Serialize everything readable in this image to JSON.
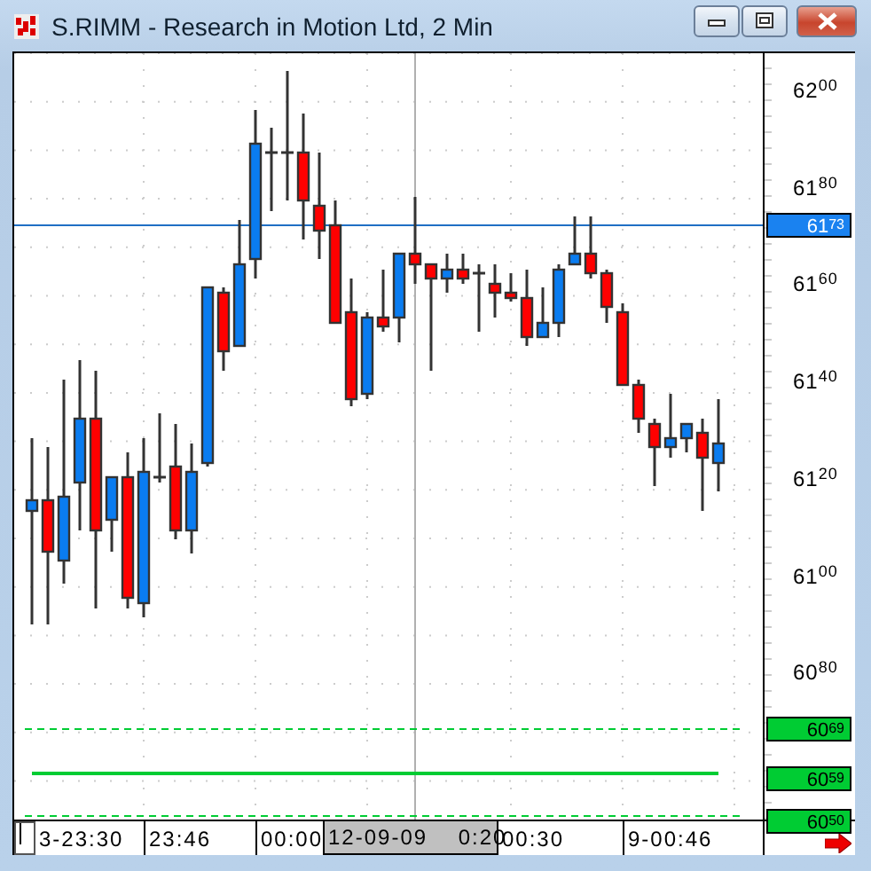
{
  "window": {
    "title": "S.RIMM - Research in Motion Ltd, 2 Min"
  },
  "price_axis": {
    "labels": [
      "62$^{00}$",
      "61$^{80}$",
      "61$^{60}$",
      "61$^{40}$",
      "61$^{20}$",
      "61$^{00}$",
      "60$^{80}$"
    ],
    "markers": [
      {
        "label": "61$^{73}$",
        "color": "#1a82f0"
      },
      {
        "label": "60$^{69}$",
        "color": "#00cc33"
      },
      {
        "label": "60$^{59}$",
        "color": "#00cc33"
      },
      {
        "label": "60$^{50}$",
        "color": "#00cc33"
      }
    ]
  },
  "time_axis": {
    "labels": [
      {
        "text": "3-23:30",
        "highlighted": false
      },
      {
        "text": "23:46",
        "highlighted": false
      },
      {
        "text": "00:00",
        "highlighted": false
      },
      {
        "text": "12-09-09    0:20",
        "highlighted": true
      },
      {
        "text": "00:30",
        "highlighted": false
      },
      {
        "text": "9-00:46",
        "highlighted": false
      }
    ]
  }
}
